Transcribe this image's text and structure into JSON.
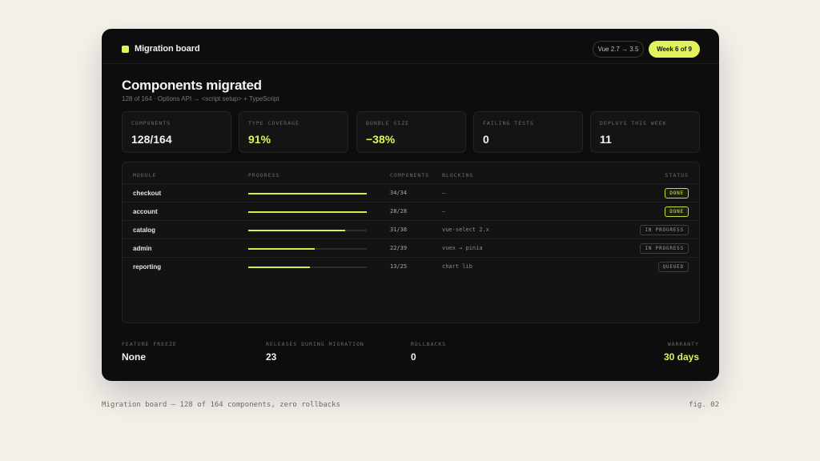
{
  "header": {
    "title": "Migration board",
    "version_pill": "Vue 2.7 → 3.5",
    "week_pill": "Week 6 of 9",
    "accent_color": "#e3f25a"
  },
  "summary": {
    "heading": "Components migrated",
    "subheading": "128 of 164 · Options API → <script setup> + TypeScript"
  },
  "kpis": [
    {
      "label": "COMPONENTS",
      "value": "128/164"
    },
    {
      "label": "TYPE COVERAGE",
      "value": "91%"
    },
    {
      "label": "BUNDLE SIZE",
      "value": "−38%"
    },
    {
      "label": "FAILING TESTS",
      "value": "0"
    },
    {
      "label": "DEPLOYS THIS WEEK",
      "value": "11"
    }
  ],
  "table": {
    "columns": [
      "MODULE",
      "PROGRESS",
      "COMPONENTS",
      "BLOCKING",
      "STATUS"
    ],
    "rows": [
      {
        "module": "checkout",
        "progress": 1.0,
        "components": "34/34",
        "blocking": "—",
        "status": "DONE"
      },
      {
        "module": "account",
        "progress": 1.0,
        "components": "28/28",
        "blocking": "—",
        "status": "DONE"
      },
      {
        "module": "catalog",
        "progress": 0.82,
        "components": "31/38",
        "blocking": "vue-select 2.x",
        "status": "IN PROGRESS"
      },
      {
        "module": "admin",
        "progress": 0.56,
        "components": "22/39",
        "blocking": "vuex → pinia",
        "status": "IN PROGRESS"
      },
      {
        "module": "reporting",
        "progress": 0.52,
        "components": "13/25",
        "blocking": "chart lib",
        "status": "QUEUED"
      }
    ]
  },
  "footer": [
    {
      "label": "FEATURE FREEZE",
      "value": "None"
    },
    {
      "label": "RELEASES DURING MIGRATION",
      "value": "23"
    },
    {
      "label": "ROLLBACKS",
      "value": "0"
    },
    {
      "label": "WARRANTY",
      "value": "30 days"
    }
  ],
  "caption": {
    "text": "Migration board — 128 of 164 components, zero rollbacks",
    "fig": "fig. 02"
  }
}
